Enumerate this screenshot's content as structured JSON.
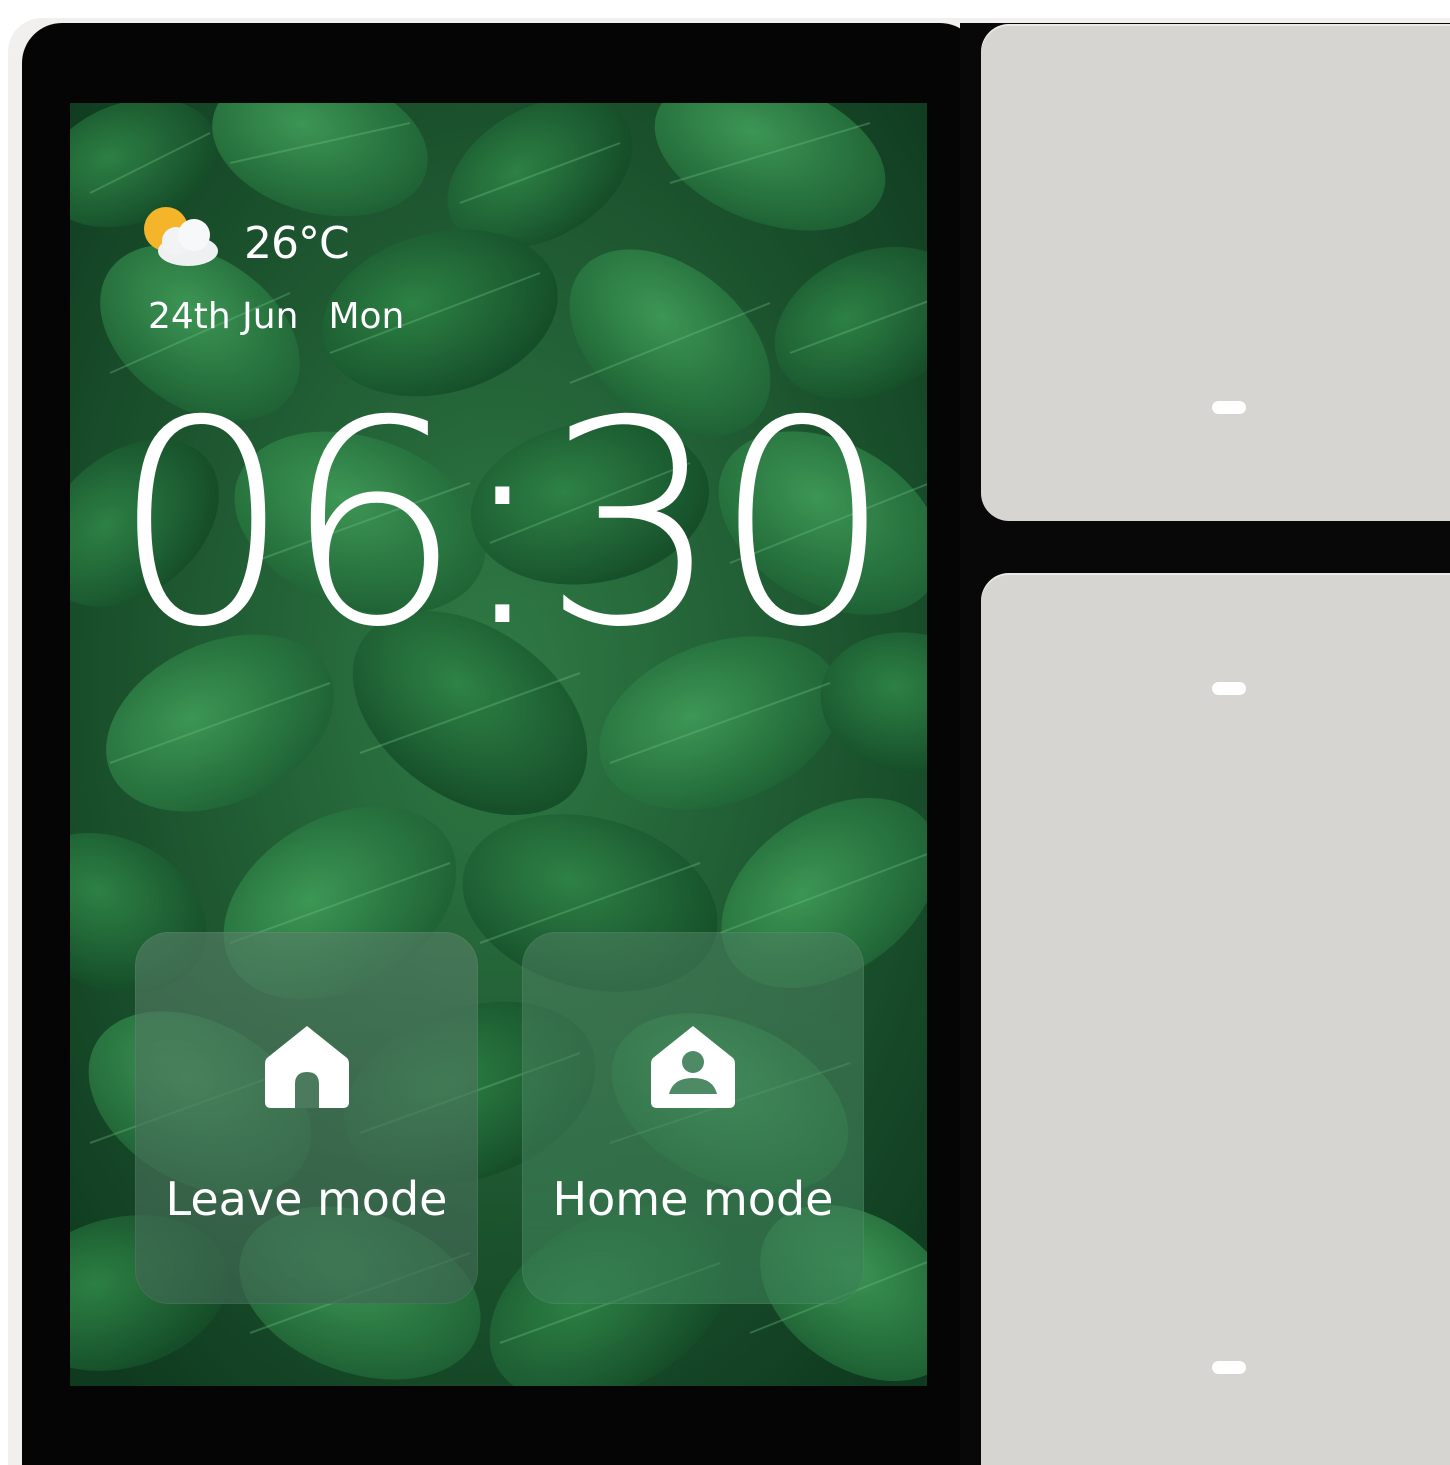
{
  "weather": {
    "icon": "partly-cloudy-icon",
    "temperature": "26°C"
  },
  "date": {
    "day_month": "24th Jun",
    "weekday": "Mon"
  },
  "clock": {
    "time": "06:30"
  },
  "modes": [
    {
      "label": "Leave mode",
      "icon": "house-icon"
    },
    {
      "label": "Home mode",
      "icon": "home-person-icon"
    }
  ],
  "colors": {
    "screen_background": "#1d5a34",
    "bezel": "#050505",
    "rocker": "#d6d5d2",
    "text": "#ffffff"
  }
}
